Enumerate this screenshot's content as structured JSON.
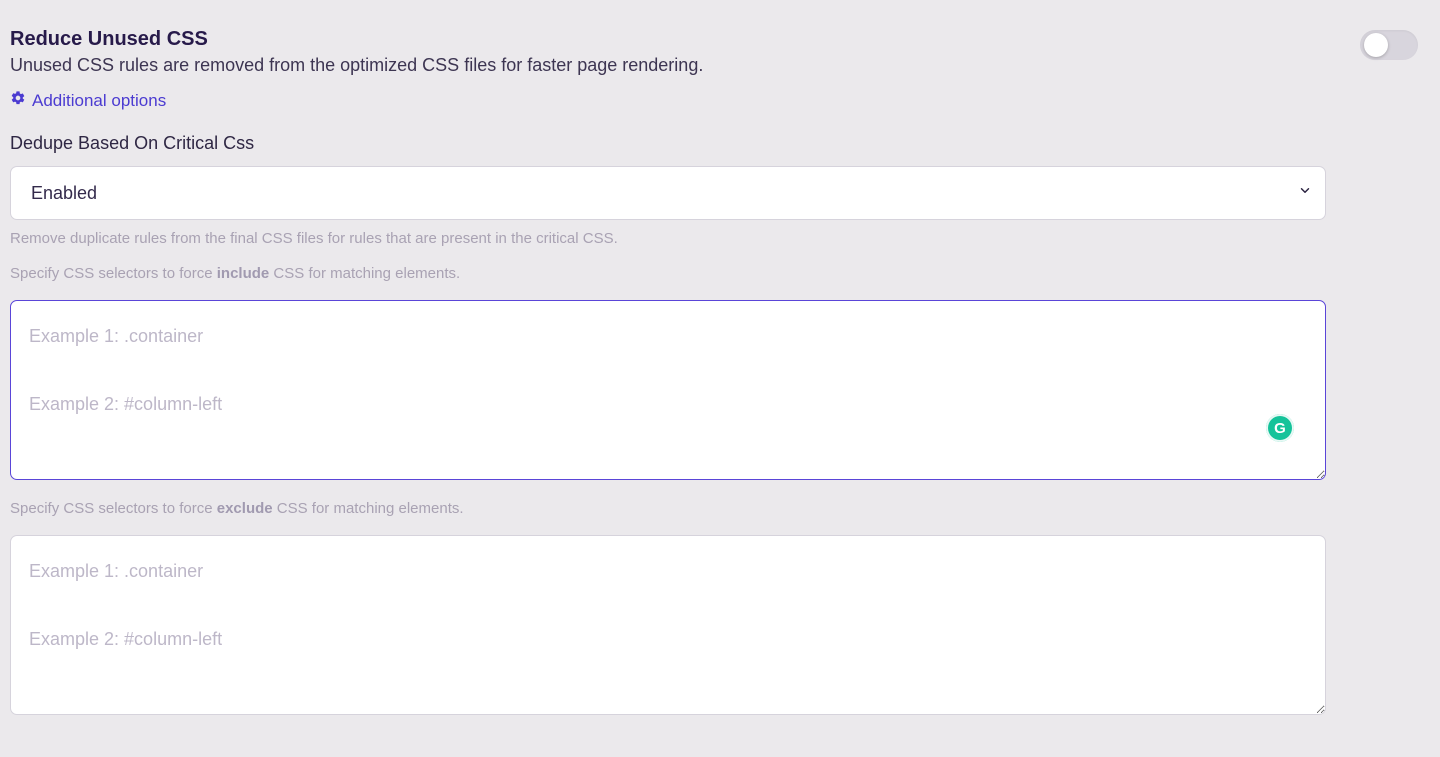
{
  "header": {
    "title": "Reduce Unused CSS",
    "subtitle": "Unused CSS rules are removed from the optimized CSS files for faster page rendering.",
    "additional_options": "Additional options",
    "toggle_on": false
  },
  "dedupe": {
    "label": "Dedupe Based On Critical Css",
    "selected": "Enabled",
    "options": [
      "Enabled"
    ],
    "helper": "Remove duplicate rules from the final CSS files for rules that are present in the critical CSS."
  },
  "include": {
    "label_pre": "Specify CSS selectors to force ",
    "label_strong": "include",
    "label_post": " CSS for matching elements.",
    "placeholder": "Example 1: .container\n\nExample 2: #column-left",
    "value": ""
  },
  "exclude": {
    "label_pre": "Specify CSS selectors to force ",
    "label_strong": "exclude",
    "label_post": " CSS for matching elements.",
    "placeholder": "Example 1: .container\n\nExample 2: #column-left",
    "value": ""
  },
  "icons": {
    "grammarly_letter": "G"
  }
}
